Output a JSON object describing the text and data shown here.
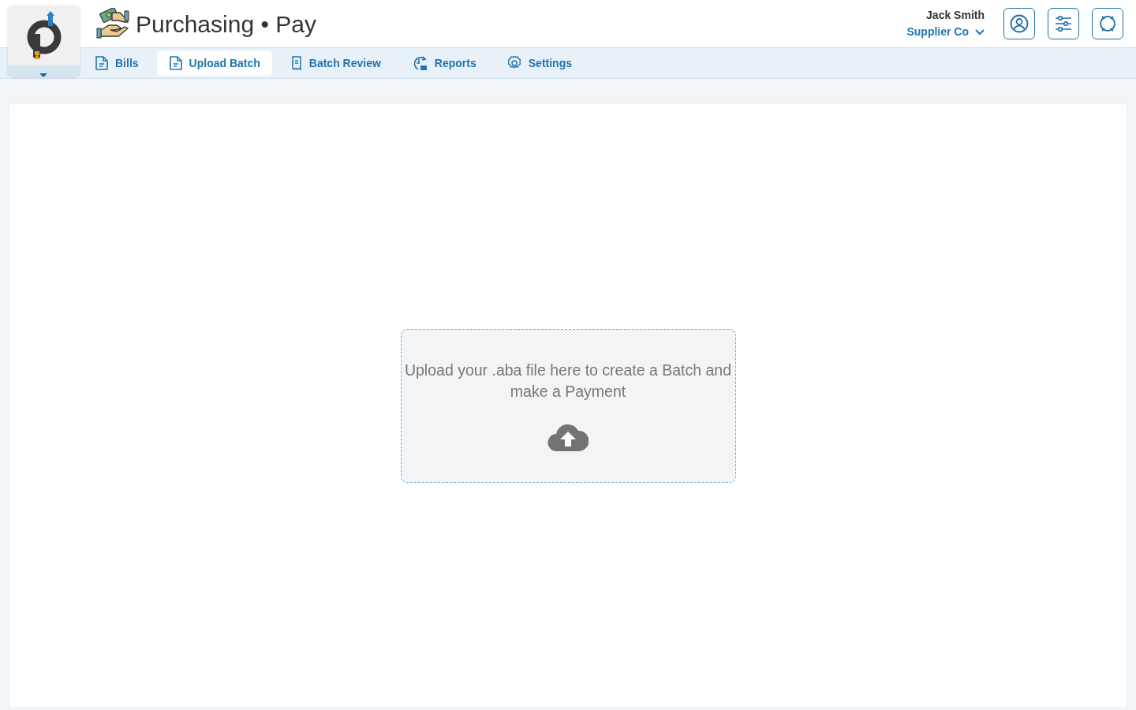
{
  "app": {
    "title": "Purchasing • Pay"
  },
  "user": {
    "name": "Jack Smith",
    "company": "Supplier Co"
  },
  "tabs": [
    {
      "label": "Bills",
      "kind": "document",
      "selected": false
    },
    {
      "label": "Upload Batch",
      "kind": "document",
      "selected": true
    },
    {
      "label": "Batch Review",
      "kind": "receipt",
      "selected": false
    },
    {
      "label": "Reports",
      "kind": "clock",
      "selected": false
    },
    {
      "label": "Settings",
      "kind": "gear",
      "selected": false
    }
  ],
  "header_buttons": [
    {
      "kind": "profile"
    },
    {
      "kind": "sliders"
    },
    {
      "kind": "help"
    }
  ],
  "upload": {
    "message": "Upload your .aba file here to create a Batch and make a Payment"
  }
}
